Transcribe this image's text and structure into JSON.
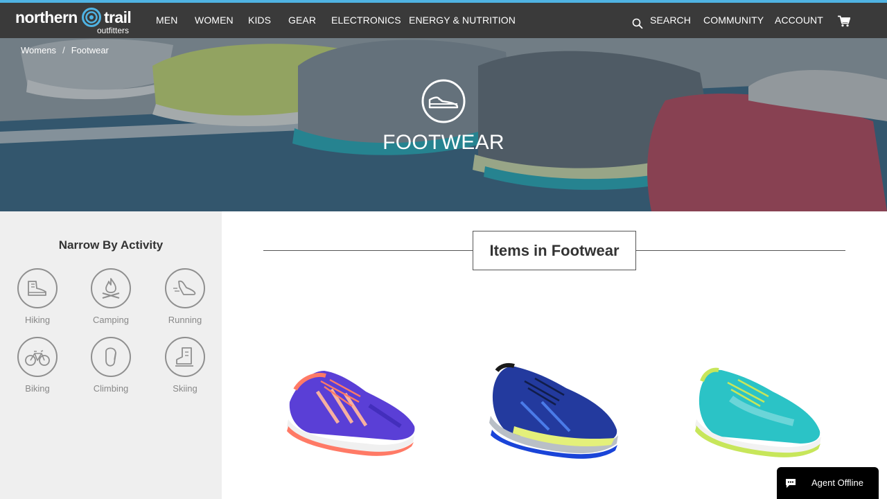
{
  "brand": {
    "name_part1": "northern",
    "name_part2": "trail",
    "tagline": "outfitters",
    "accent": "#4fb3e3"
  },
  "nav": {
    "items": [
      "MEN",
      "WOMEN",
      "KIDS",
      "GEAR",
      "ELECTRONICS",
      "ENERGY & NUTRITION"
    ],
    "search_label": "SEARCH",
    "community_label": "COMMUNITY",
    "account_label": "ACCOUNT"
  },
  "breadcrumb": {
    "parent": "Womens",
    "separator": "/",
    "current": "Footwear"
  },
  "hero": {
    "title": "FOOTWEAR",
    "icon": "shoe-icon"
  },
  "sidebar": {
    "heading": "Narrow By Activity",
    "activities": [
      {
        "label": "Hiking",
        "icon": "hiking-boot-icon"
      },
      {
        "label": "Camping",
        "icon": "campfire-icon"
      },
      {
        "label": "Running",
        "icon": "running-shoe-icon"
      },
      {
        "label": "Biking",
        "icon": "bicycle-icon"
      },
      {
        "label": "Climbing",
        "icon": "carabiner-icon"
      },
      {
        "label": "Skiing",
        "icon": "ski-boot-icon"
      }
    ]
  },
  "main": {
    "heading": "Items in Footwear",
    "products": [
      {
        "image": "purple-orange-running-shoe"
      },
      {
        "image": "blue-navy-running-shoe"
      },
      {
        "image": "teal-lime-running-shoe"
      }
    ]
  },
  "agent": {
    "label": "Agent Offline",
    "icon": "chat-bubble-icon"
  }
}
